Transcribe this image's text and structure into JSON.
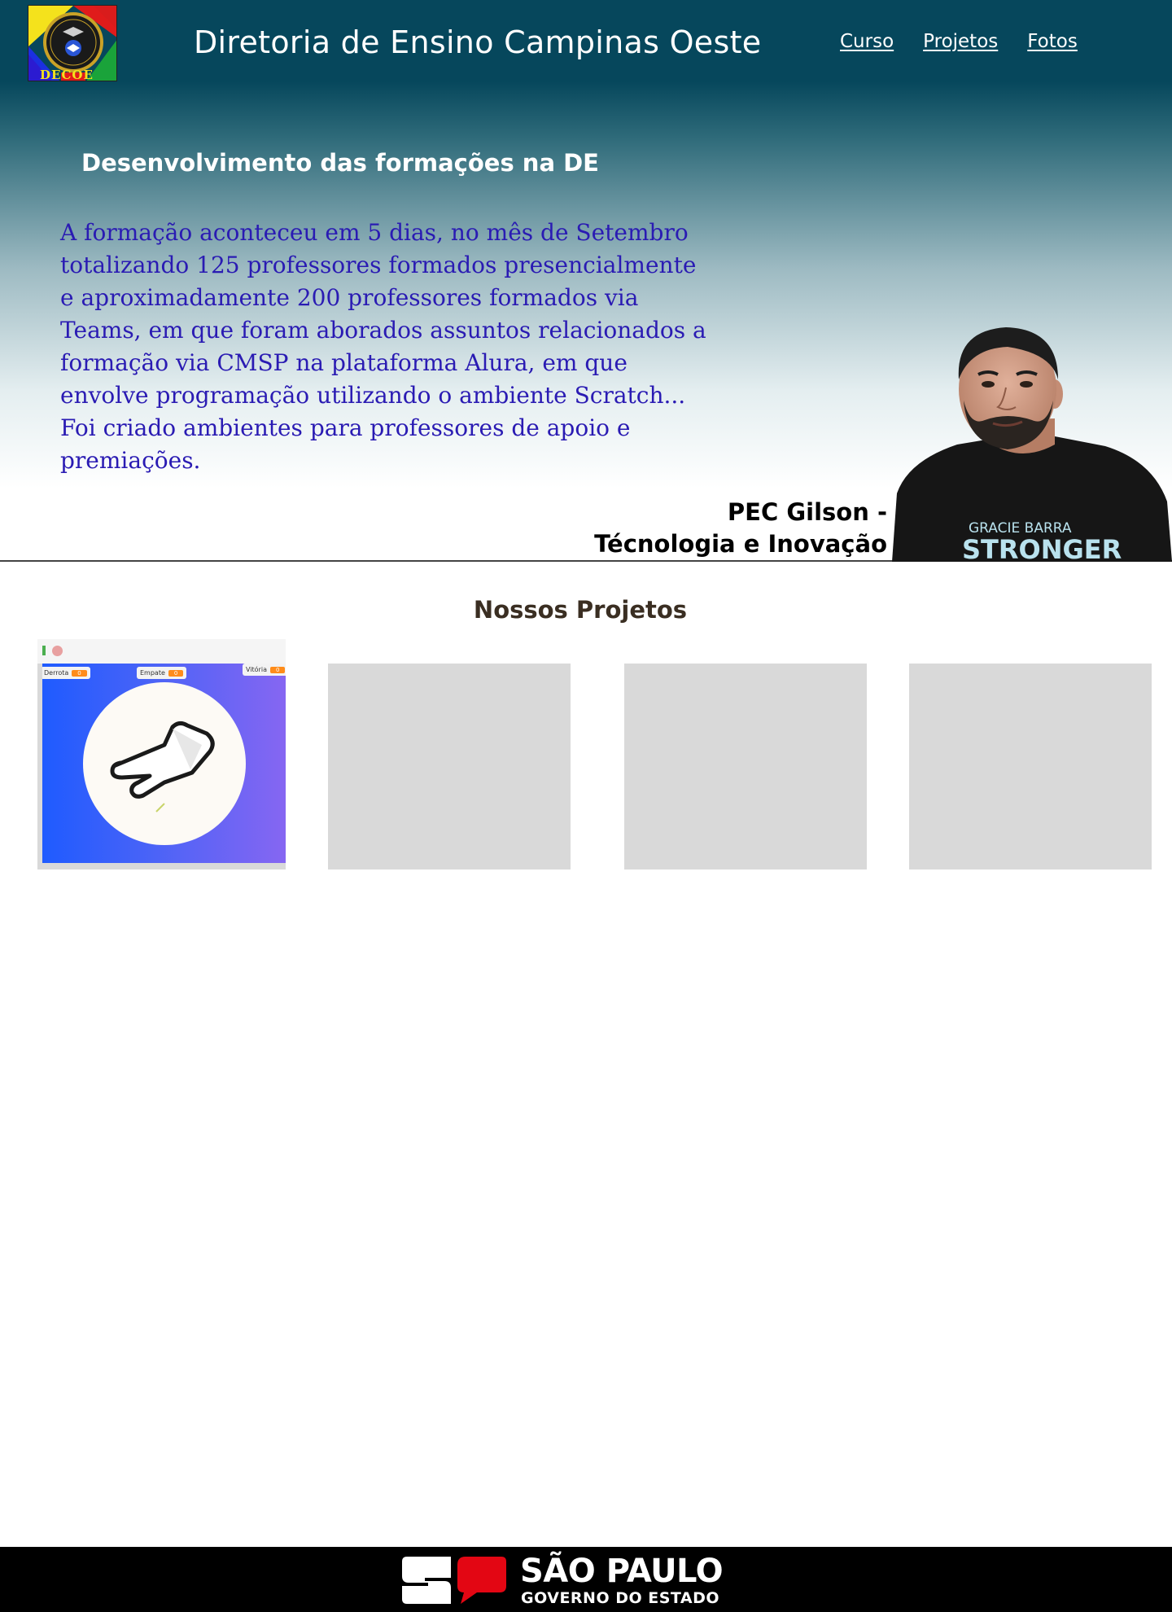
{
  "header": {
    "title": "Diretoria de Ensino Campinas Oeste",
    "logo_text": "DECOE",
    "nav": [
      {
        "label": "Curso"
      },
      {
        "label": "Projetos"
      },
      {
        "label": "Fotos"
      }
    ]
  },
  "hero": {
    "heading": "Desenvolvimento das formações na DE",
    "paragraph_lines": [
      "A formação aconteceu em 5 dias, no mês de Setembro",
      "totalizando 125 professores formados presencialmente",
      "e aproximadamente 200 professores formados via",
      "Teams, em que foram aborados assuntos relacionados a",
      "formação via CMSP na plataforma Alura, em que",
      "envolve programação utilizando o ambiente Scratch...",
      "Foi criado ambientes para professores de apoio e",
      "premiações."
    ],
    "pec_line1": "PEC Gilson -",
    "pec_line2": "Técnologia e Inovação",
    "shirt_text_1": "GRACIE BARRA",
    "shirt_text_2": "STRONGER"
  },
  "projects": {
    "title": "Nossos Projetos",
    "scratch": {
      "score_labels": [
        "Derrota",
        "Empate",
        "Vitória"
      ],
      "score_values": [
        "0",
        "0",
        "0"
      ]
    }
  },
  "footer": {
    "brand_line1": "SÃO PAULO",
    "brand_line2": "GOVERNO DO ESTADO"
  },
  "colors": {
    "header_bg": "#06475c",
    "paragraph_text": "#2a1bb3",
    "placeholder_card": "#d9d9d9",
    "footer_bg": "#000000",
    "footer_red": "#e30613"
  }
}
